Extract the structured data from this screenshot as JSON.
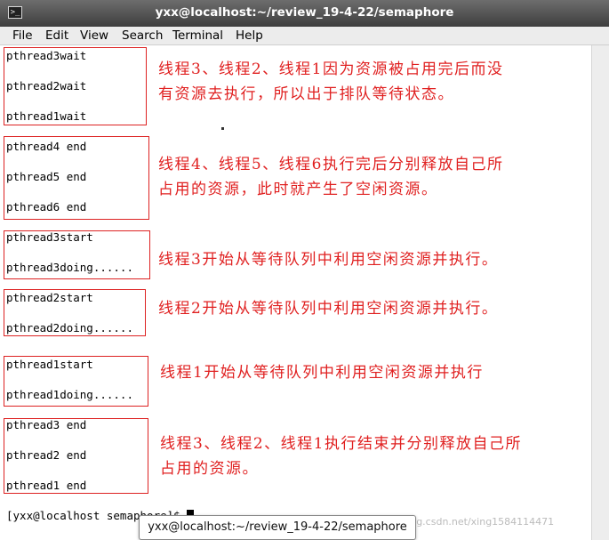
{
  "window": {
    "title": "yxx@localhost:~/review_19-4-22/semaphore",
    "icon": "terminal-icon"
  },
  "menu": [
    "File",
    "Edit",
    "View",
    "Search",
    "Terminal",
    "Help"
  ],
  "terminal_lines": [
    "pthread3wait",
    "pthread2wait",
    "pthread1wait",
    "pthread4 end",
    "pthread5 end",
    "pthread6 end",
    "pthread3start",
    "pthread3doing......",
    "pthread2start",
    "pthread2doing......",
    "pthread1start",
    "pthread1doing......",
    "pthread3 end",
    "pthread2 end",
    "pthread1 end"
  ],
  "prompt": "[yxx@localhost semaphore]$ ",
  "annotations": [
    "线程3、线程2、线程1因为资源被占用完后而没",
    "有资源去执行，所以出于排队等待状态。",
    "线程4、线程5、线程6执行完后分别释放自己所",
    "占用的资源，此时就产生了空闲资源。",
    "线程3开始从等待队列中利用空闲资源并执行。",
    "线程2开始从等待队列中利用空闲资源并执行。",
    "线程1开始从等待队列中利用空闲资源并执行",
    "线程3、线程2、线程1执行结束并分别释放自己所",
    "占用的资源。"
  ],
  "tooltip": "yxx@localhost:~/review_19-4-22/semaphore",
  "watermark": "https://blog.csdn.net/xing1584114471",
  "colors": {
    "annotation": "#e02020",
    "titlebar": "#4a4a4a",
    "menubar": "#ececec"
  }
}
